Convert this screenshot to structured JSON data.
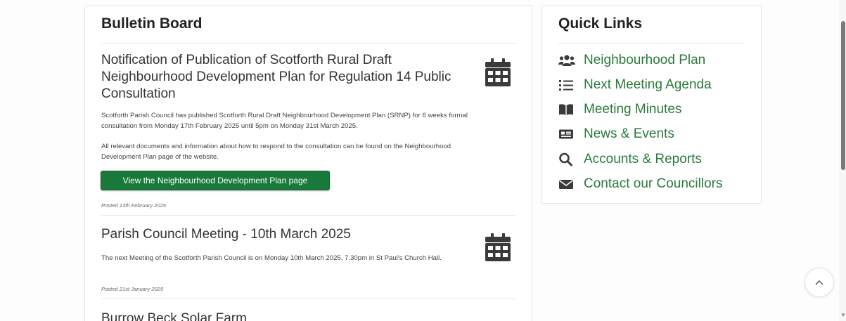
{
  "bulletin": {
    "title": "Bulletin Board",
    "posts": [
      {
        "title": "Notification of Publication of Scotforth Rural Draft Neighbourhood Development Plan for Regulation 14 Public Consultation",
        "paragraphs": [
          "Scotforth Parish Council has published Scotforth Rural Draft Neighbourhood Development Plan (SRNP) for 6 weeks formal consultation from Monday 17th February 2025 until 5pm on Monday 31st March 2025.",
          "All relevant documents and information about how to respond to the consultation can be found on the Neighbourhood Development Plan page of the website."
        ],
        "button_label": "View the Neighbourhood Development Plan page",
        "posted": "Posted 13th February 2025",
        "icon": "calendar-icon"
      },
      {
        "title": "Parish Council Meeting - 10th March 2025",
        "paragraphs": [
          "The next Meeting of the Scotforth Parish Council is on Monday 10th March 2025, 7.30pm in St Paul's Church Hall."
        ],
        "posted": "Posted 21st January 2025",
        "icon": "calendar-icon"
      },
      {
        "title": "Burrow Beck Solar Farm"
      }
    ]
  },
  "quick_links": {
    "title": "Quick Links",
    "items": [
      {
        "label": "Neighbourhood Plan",
        "icon": "users-icon"
      },
      {
        "label": "Next Meeting Agenda",
        "icon": "list-icon"
      },
      {
        "label": "Meeting Minutes",
        "icon": "book-icon"
      },
      {
        "label": "News & Events",
        "icon": "newspaper-icon"
      },
      {
        "label": "Accounts & Reports",
        "icon": "search-icon"
      },
      {
        "label": "Contact our Councillors",
        "icon": "envelope-icon"
      }
    ]
  },
  "colors": {
    "accent_green": "#1a7a3c",
    "link_green": "#2a7a3a",
    "icon_dark": "#3a3a3a"
  },
  "back_to_top_icon": "chevron-up-icon"
}
